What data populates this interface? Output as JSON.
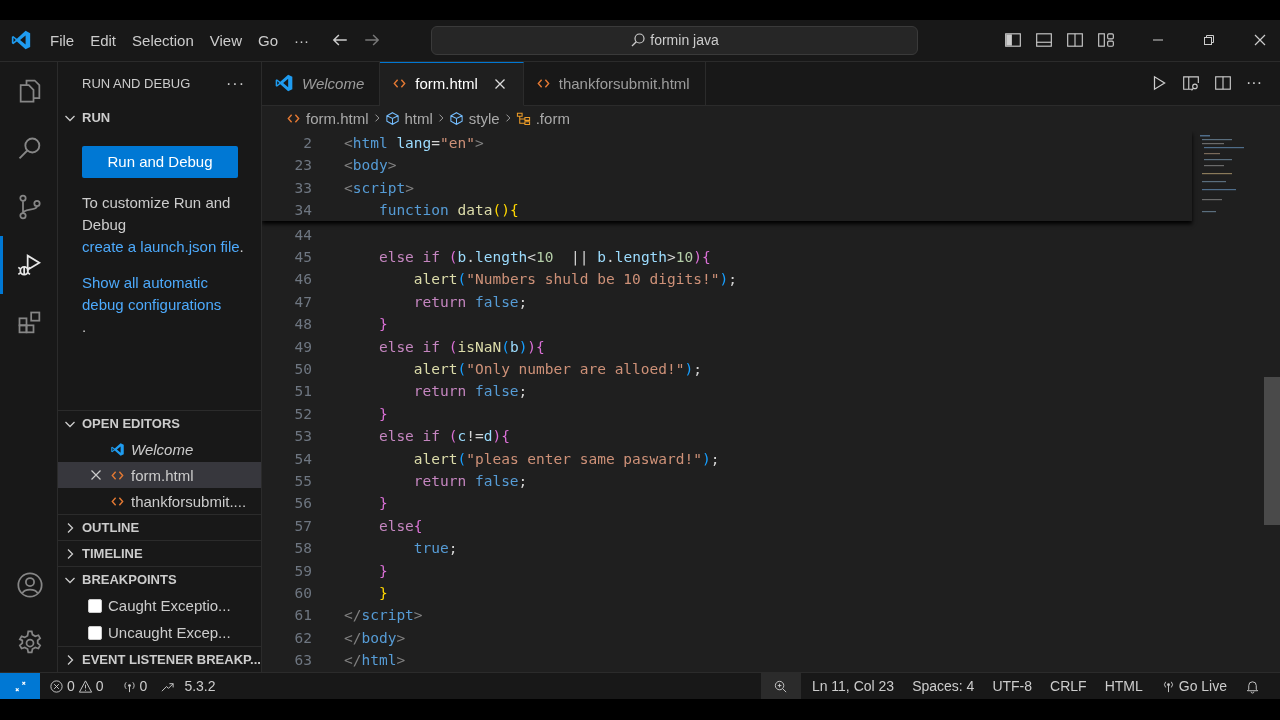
{
  "titlebar": {
    "menu": [
      "File",
      "Edit",
      "Selection",
      "View",
      "Go"
    ],
    "more": "···",
    "search": "formin java"
  },
  "activity_bar": [
    {
      "kind": "explorer",
      "selected": false
    },
    {
      "kind": "search",
      "selected": false
    },
    {
      "kind": "scm",
      "selected": false
    },
    {
      "kind": "debug",
      "selected": true
    },
    {
      "kind": "extensions",
      "selected": false
    }
  ],
  "activity_bottom": [
    {
      "kind": "account"
    },
    {
      "kind": "settings"
    }
  ],
  "sidebar": {
    "title": "RUN AND DEBUG",
    "more": "···",
    "run_section": {
      "title": "RUN",
      "expanded": true,
      "button": "Run and Debug",
      "text": "To customize Run and Debug ",
      "link": "create a launch.json file",
      "text_after": ".",
      "link2": "Show all automatic debug configurations",
      "link2_after": "."
    },
    "sections": [
      {
        "title": "OPEN EDITORS",
        "expanded": true,
        "kind": "editors",
        "items": [
          {
            "label": "Welcome",
            "kind": "vscode",
            "preview": true,
            "selected": false
          },
          {
            "label": "form.html",
            "kind": "html",
            "preview": false,
            "selected": true
          },
          {
            "label": "thankforsubmit....",
            "kind": "html",
            "preview": false,
            "selected": false
          }
        ]
      },
      {
        "title": "OUTLINE",
        "expanded": false
      },
      {
        "title": "TIMELINE",
        "expanded": false
      },
      {
        "title": "BREAKPOINTS",
        "expanded": true,
        "kind": "breakpoints",
        "items": [
          {
            "label": "Caught Exceptio...",
            "checked": false
          },
          {
            "label": "Uncaught Excep...",
            "checked": false
          }
        ]
      },
      {
        "title": "EVENT LISTENER BREAKP...",
        "expanded": false
      }
    ]
  },
  "tabs": [
    {
      "label": "Welcome",
      "kind": "vscode",
      "preview": true,
      "selected": false
    },
    {
      "label": "form.html",
      "kind": "html",
      "preview": false,
      "selected": true
    },
    {
      "label": "thankforsubmit.html",
      "kind": "html",
      "preview": false,
      "selected": false
    }
  ],
  "editor_actions_more": "···",
  "breadcrumb": [
    {
      "label": "form.html",
      "kind": "html"
    },
    {
      "label": "html",
      "kind": "symbol"
    },
    {
      "label": "style",
      "kind": "symbol"
    },
    {
      "label": ".form",
      "kind": "struct"
    }
  ],
  "sticky_lines": [
    {
      "n": "2",
      "tokens": [
        {
          "kind": "p",
          "text": "<"
        },
        {
          "kind": "tag",
          "text": "html "
        },
        {
          "kind": "attr",
          "text": "lang"
        },
        {
          "kind": "t",
          "text": "="
        },
        {
          "kind": "s",
          "text": "\"en\""
        },
        {
          "kind": "p",
          "text": ">"
        }
      ]
    },
    {
      "n": "23",
      "tokens": [
        {
          "kind": "p",
          "text": "<"
        },
        {
          "kind": "tag",
          "text": "body"
        },
        {
          "kind": "p",
          "text": ">"
        }
      ]
    },
    {
      "n": "33",
      "tokens": [
        {
          "kind": "p",
          "text": "<"
        },
        {
          "kind": "tag",
          "text": "script"
        },
        {
          "kind": "p",
          "text": ">"
        }
      ]
    },
    {
      "n": "34",
      "tokens": [
        {
          "kind": "kw",
          "text": "    function "
        },
        {
          "kind": "fn",
          "text": "data"
        },
        {
          "kind": "b1",
          "text": "(){"
        }
      ]
    }
  ],
  "lines": [
    {
      "n": "44"
    },
    {
      "n": "45",
      "tokens": [
        {
          "kind": "ctl",
          "text": "    else if "
        },
        {
          "kind": "b2",
          "text": "("
        },
        {
          "kind": "v",
          "text": "b"
        },
        {
          "kind": "t",
          "text": "."
        },
        {
          "kind": "v",
          "text": "length"
        },
        {
          "kind": "t",
          "text": "<"
        },
        {
          "kind": "num",
          "text": "10"
        },
        {
          "kind": "t",
          "text": "  || "
        },
        {
          "kind": "v",
          "text": "b"
        },
        {
          "kind": "t",
          "text": "."
        },
        {
          "kind": "v",
          "text": "length"
        },
        {
          "kind": "t",
          "text": ">"
        },
        {
          "kind": "num",
          "text": "10"
        },
        {
          "kind": "b2",
          "text": "){"
        }
      ]
    },
    {
      "n": "46",
      "tokens": [
        {
          "kind": "fn",
          "text": "        alert"
        },
        {
          "kind": "b3",
          "text": "("
        },
        {
          "kind": "s",
          "text": "\"Numbers shuld be 10 digits!\""
        },
        {
          "kind": "b3",
          "text": ")"
        },
        {
          "kind": "t",
          "text": ";"
        }
      ]
    },
    {
      "n": "47",
      "tokens": [
        {
          "kind": "ctl",
          "text": "        return "
        },
        {
          "kind": "kw",
          "text": "false"
        },
        {
          "kind": "t",
          "text": ";"
        }
      ]
    },
    {
      "n": "48",
      "tokens": [
        {
          "kind": "b2",
          "text": "    }"
        }
      ]
    },
    {
      "n": "49",
      "tokens": [
        {
          "kind": "ctl",
          "text": "    else if "
        },
        {
          "kind": "b2",
          "text": "("
        },
        {
          "kind": "fn",
          "text": "isNaN"
        },
        {
          "kind": "b3",
          "text": "("
        },
        {
          "kind": "v",
          "text": "b"
        },
        {
          "kind": "b3",
          "text": ")"
        },
        {
          "kind": "b2",
          "text": "){"
        }
      ]
    },
    {
      "n": "50",
      "tokens": [
        {
          "kind": "fn",
          "text": "        alert"
        },
        {
          "kind": "b3",
          "text": "("
        },
        {
          "kind": "s",
          "text": "\"Only number are alloed!\""
        },
        {
          "kind": "b3",
          "text": ")"
        },
        {
          "kind": "t",
          "text": ";"
        }
      ]
    },
    {
      "n": "51",
      "tokens": [
        {
          "kind": "ctl",
          "text": "        return "
        },
        {
          "kind": "kw",
          "text": "false"
        },
        {
          "kind": "t",
          "text": ";"
        }
      ]
    },
    {
      "n": "52",
      "tokens": [
        {
          "kind": "b2",
          "text": "    }"
        }
      ]
    },
    {
      "n": "53",
      "tokens": [
        {
          "kind": "ctl",
          "text": "    else if "
        },
        {
          "kind": "b2",
          "text": "("
        },
        {
          "kind": "v",
          "text": "c"
        },
        {
          "kind": "t",
          "text": "!="
        },
        {
          "kind": "v",
          "text": "d"
        },
        {
          "kind": "b2",
          "text": "){"
        }
      ]
    },
    {
      "n": "54",
      "tokens": [
        {
          "kind": "fn",
          "text": "        alert"
        },
        {
          "kind": "b3",
          "text": "("
        },
        {
          "kind": "s",
          "text": "\"pleas enter same pasward!\""
        },
        {
          "kind": "b3",
          "text": ")"
        },
        {
          "kind": "t",
          "text": ";"
        }
      ]
    },
    {
      "n": "55",
      "tokens": [
        {
          "kind": "ctl",
          "text": "        return "
        },
        {
          "kind": "kw",
          "text": "false"
        },
        {
          "kind": "t",
          "text": ";"
        }
      ]
    },
    {
      "n": "56",
      "tokens": [
        {
          "kind": "b2",
          "text": "    }"
        }
      ]
    },
    {
      "n": "57",
      "tokens": [
        {
          "kind": "ctl",
          "text": "    else"
        },
        {
          "kind": "b2",
          "text": "{"
        }
      ]
    },
    {
      "n": "58",
      "tokens": [
        {
          "kind": "kw",
          "text": "        true"
        },
        {
          "kind": "t",
          "text": ";"
        }
      ]
    },
    {
      "n": "59",
      "tokens": [
        {
          "kind": "b2",
          "text": "    }"
        }
      ]
    },
    {
      "n": "60",
      "tokens": [
        {
          "kind": "b1",
          "text": "    }"
        }
      ]
    },
    {
      "n": "61",
      "tokens": [
        {
          "kind": "p",
          "text": "</"
        },
        {
          "kind": "tag",
          "text": "script"
        },
        {
          "kind": "p",
          "text": ">"
        }
      ]
    },
    {
      "n": "62",
      "tokens": [
        {
          "kind": "p",
          "text": "</"
        },
        {
          "kind": "tag",
          "text": "body"
        },
        {
          "kind": "p",
          "text": ">"
        }
      ]
    },
    {
      "n": "63",
      "tokens": [
        {
          "kind": "p",
          "text": "</"
        },
        {
          "kind": "tag",
          "text": "html"
        },
        {
          "kind": "p",
          "text": ">"
        }
      ]
    }
  ],
  "status_bar": {
    "errors": "0",
    "warnings": "0",
    "ports": "0",
    "version": "5.3.2",
    "right": [
      {
        "kind": "zoom"
      },
      {
        "kind": "text",
        "label": "Ln 11, Col 23"
      },
      {
        "kind": "text",
        "label": "Spaces: 4"
      },
      {
        "kind": "text",
        "label": "UTF-8"
      },
      {
        "kind": "text",
        "label": "CRLF"
      },
      {
        "kind": "text",
        "label": "HTML"
      },
      {
        "kind": "golive",
        "label": "Go Live"
      },
      {
        "kind": "bell"
      }
    ]
  }
}
